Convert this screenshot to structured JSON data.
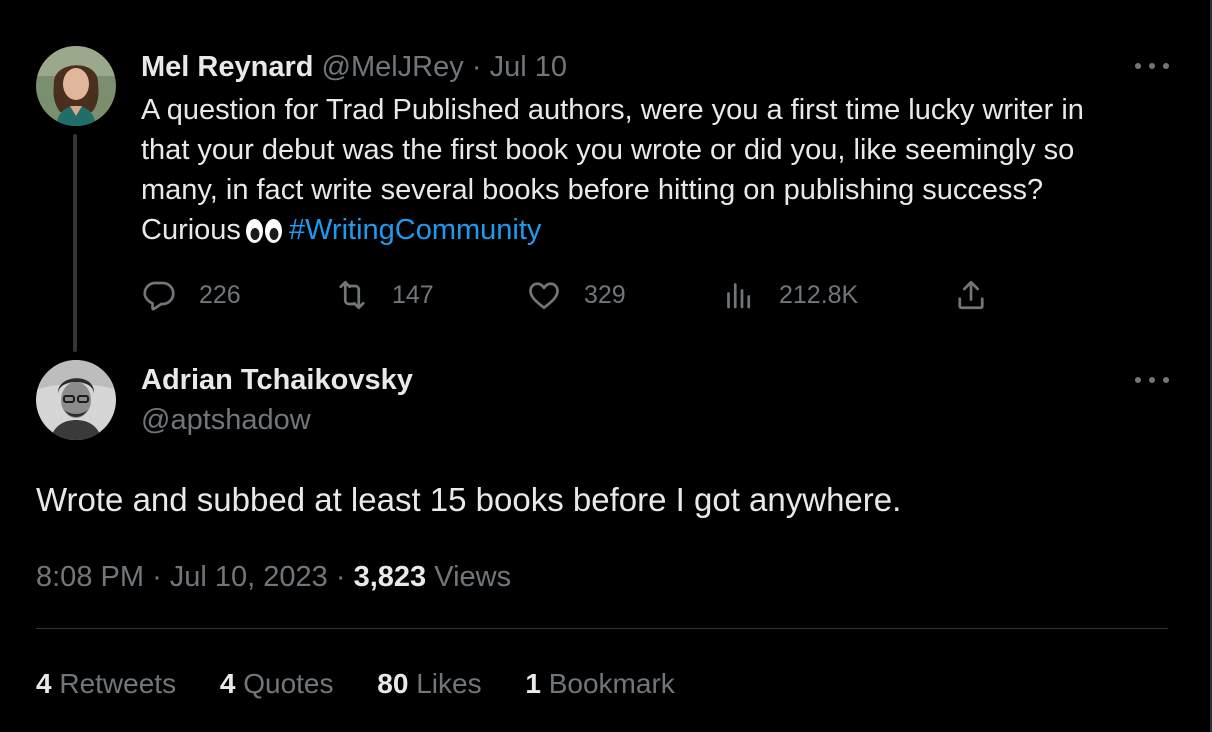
{
  "parent_tweet": {
    "author_name": "Mel Reynard",
    "handle": "@MelJRey",
    "separator": "·",
    "date": "Jul 10",
    "text_lines": [
      "A question for Trad Published authors, were you a first time lucky writer in",
      "that your debut was the first book you wrote or did you, like seemingly so",
      "many, in fact write several books before hitting on publishing success?"
    ],
    "text_last_prefix": "Curious",
    "text_emoji": "eyes-emoji",
    "hashtag": "#WritingCommunity",
    "actions": {
      "replies": "226",
      "retweets": "147",
      "likes": "329",
      "views": "212.8K"
    },
    "avatar": "woman-portrait-avatar"
  },
  "reply_tweet": {
    "author_name": "Adrian Tchaikovsky",
    "handle": "@aptshadow",
    "text": "Wrote and subbed at least 15 books before I got anywhere.",
    "time": "8:08 PM",
    "sep1": "·",
    "date": "Jul 10, 2023",
    "sep2": "·",
    "views_count": "3,823",
    "views_label": "Views",
    "avatar": "man-bw-portrait-avatar"
  },
  "stats": {
    "retweets_count": "4",
    "retweets_label": "Retweets",
    "quotes_count": "4",
    "quotes_label": "Quotes",
    "likes_count": "80",
    "likes_label": "Likes",
    "bookmarks_count": "1",
    "bookmarks_label": "Bookmark"
  },
  "colors": {
    "background": "#000000",
    "text": "#e7e9ea",
    "muted": "#71767b",
    "link": "#1d9bf0",
    "divider": "#2f3336"
  }
}
